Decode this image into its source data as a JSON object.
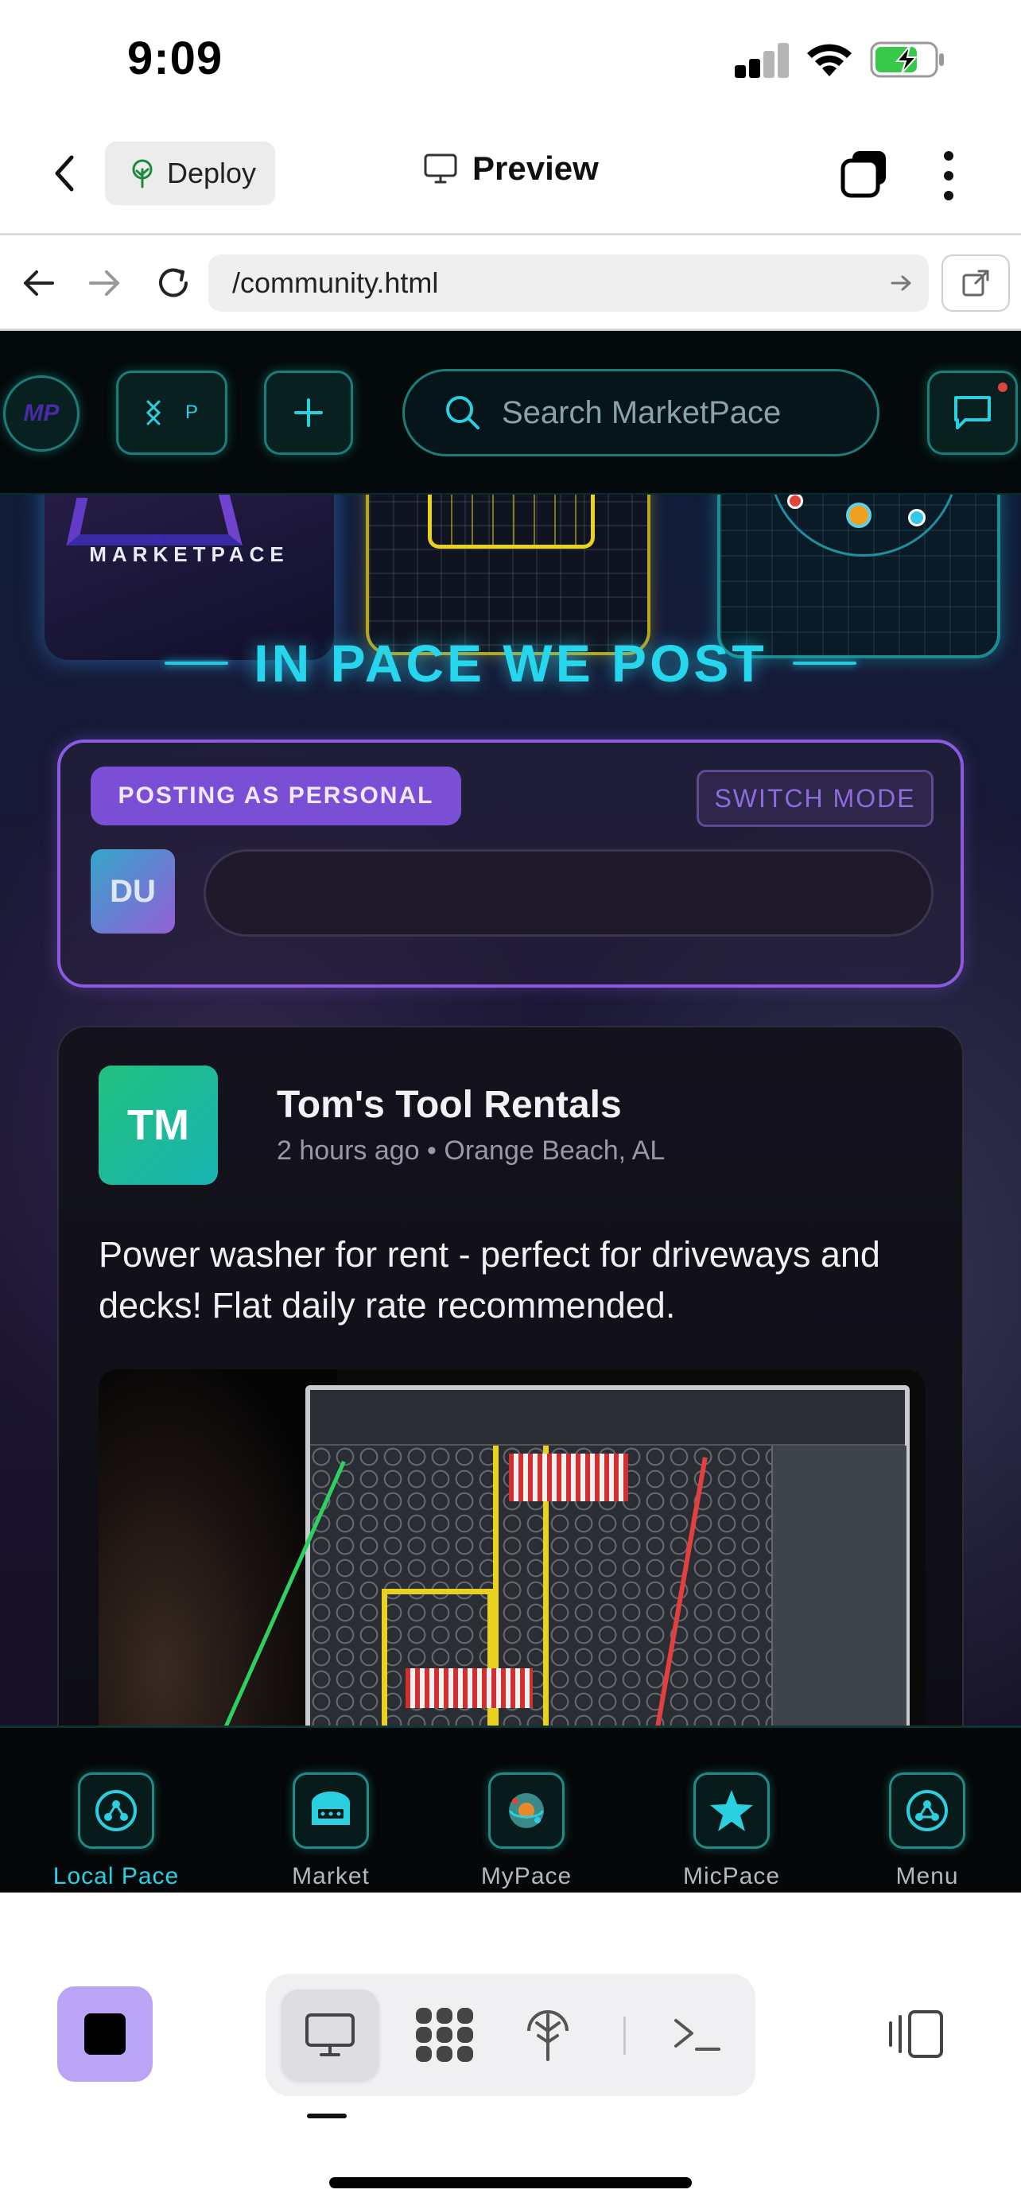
{
  "status_bar": {
    "time": "9:09"
  },
  "header": {
    "back_icon": "chevron-left-icon",
    "deploy_label": "Deploy",
    "deploy_icon": "deploy-tree-icon",
    "preview_label": "Preview",
    "preview_icon": "monitor-icon",
    "tabs_icon": "tabs-stack-icon",
    "more_icon": "more-vertical-icon"
  },
  "browser": {
    "url": "/community.html",
    "back_icon": "arrow-left-icon",
    "forward_icon": "arrow-right-icon",
    "reload_icon": "reload-icon",
    "go_icon": "arrow-right-icon",
    "external_icon": "open-external-icon"
  },
  "site": {
    "nav": {
      "logo_text": "MP",
      "toggle_text": "P",
      "search_placeholder": "Search MarketPace"
    },
    "hero": {
      "marketpace_word": "MARKETPACE",
      "heading": "IN PACE WE POST"
    },
    "composer": {
      "posting_as": "POSTING AS PERSONAL",
      "switch_mode": "SWITCH MODE",
      "avatar_initials": "DU",
      "input_placeholder": ""
    },
    "post": {
      "avatar_initials": "TM",
      "author": "Tom's Tool Rentals",
      "meta": "2 hours ago • Orange Beach, AL",
      "text": "Power washer for rent - perfect for driveways and decks! Flat daily rate recommended."
    },
    "bottom_nav": [
      {
        "label": "Local Pace",
        "icon": "community-hub-icon",
        "active": true
      },
      {
        "label": "Market",
        "icon": "storefront-icon",
        "active": false
      },
      {
        "label": "MyPace",
        "icon": "planet-icon",
        "active": false
      },
      {
        "label": "MicPace",
        "icon": "star-icon",
        "active": false
      },
      {
        "label": "Menu",
        "icon": "menu-hub-icon",
        "active": false
      }
    ]
  },
  "ide_toolbar": {
    "stop_icon": "stop-icon",
    "tools": [
      "monitor-icon",
      "apps-grid-icon",
      "deploy-tree-icon",
      "terminal-icon"
    ],
    "layout_icon": "layout-toggle-icon"
  },
  "colors": {
    "accent_teal": "#27d2e6",
    "accent_purple": "#7a4fd6",
    "stop_button": "#b9a4f5"
  }
}
